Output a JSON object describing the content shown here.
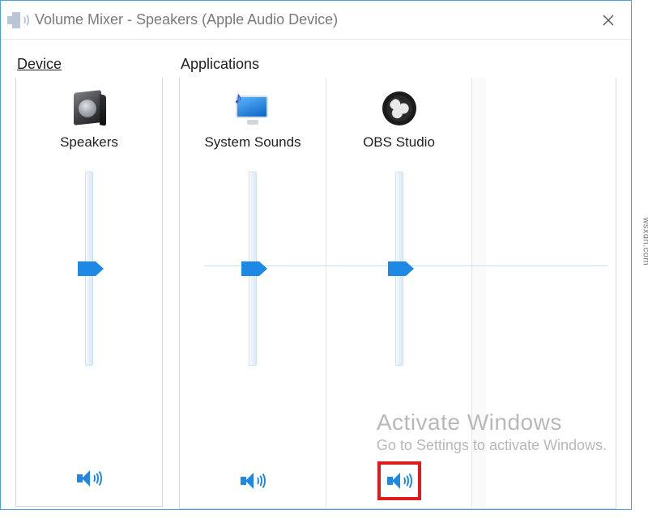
{
  "window": {
    "title": "Volume Mixer - Speakers (Apple Audio Device)"
  },
  "sections": {
    "device_label": "Device",
    "applications_label": "Applications"
  },
  "columns": [
    {
      "id": "speakers",
      "name": "Speakers",
      "icon": "speaker-device-icon",
      "volume": 50,
      "muted": false,
      "highlight": false
    },
    {
      "id": "system",
      "name": "System Sounds",
      "icon": "system-sounds-icon",
      "volume": 50,
      "muted": false,
      "highlight": false
    },
    {
      "id": "obs",
      "name": "OBS Studio",
      "icon": "obs-studio-icon",
      "volume": 50,
      "muted": false,
      "highlight": true
    }
  ],
  "watermark": {
    "line1": "Activate Windows",
    "line2": "Go to Settings to activate Windows."
  },
  "credit": "wsxdn.com"
}
